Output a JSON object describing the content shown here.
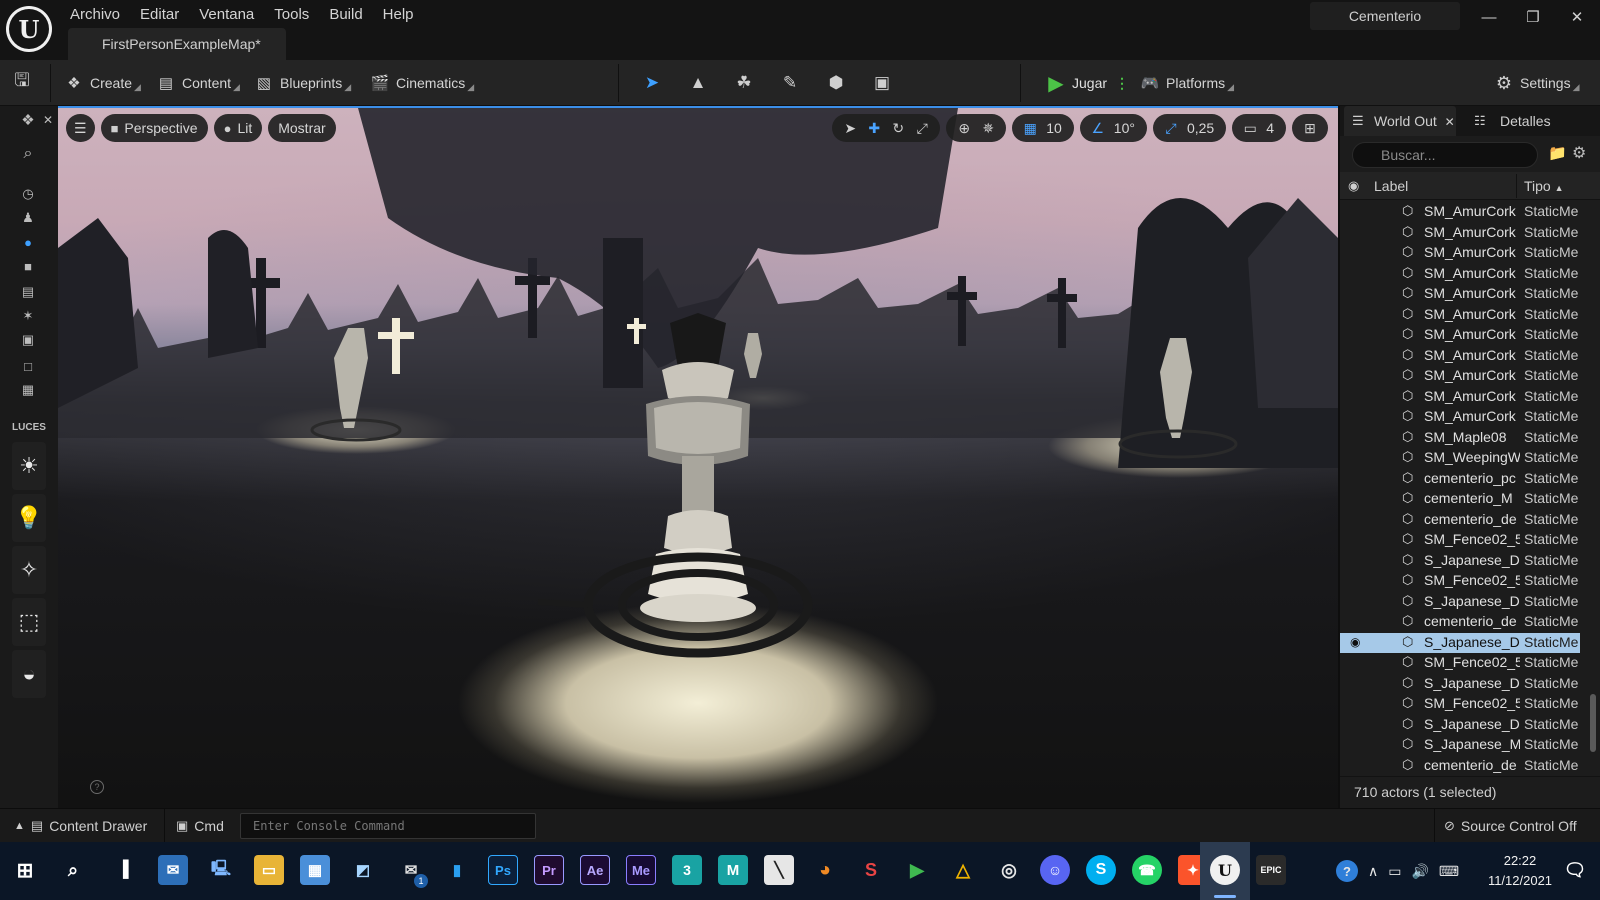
{
  "colors": {
    "accent_blue": "#3b8ee8",
    "selected_row": "#a6c9e8",
    "play_green": "#4cc247",
    "bg_dark": "#151515",
    "taskbar": "#0b1626"
  },
  "titlebar": {
    "menu": [
      "Archivo",
      "Editar",
      "Ventana",
      "Tools",
      "Build",
      "Help"
    ],
    "document_tab": "FirstPersonExampleMap*",
    "project_name": "Cementerio",
    "window_controls": [
      "minimize-icon",
      "restore-icon",
      "close-icon"
    ]
  },
  "toolbar": {
    "create": "Create",
    "content": "Content",
    "blueprints": "Blueprints",
    "cinematics": "Cinematics",
    "modes": [
      "select-mode-icon",
      "landscape-mode-icon",
      "foliage-mode-icon",
      "mesh-paint-mode-icon",
      "fracture-mode-icon",
      "modeling-mode-icon"
    ],
    "play": "Jugar",
    "platforms": "Platforms",
    "settings": "Settings"
  },
  "left_strip": {
    "section_label": "LUCES"
  },
  "viewport": {
    "perspective": "Perspective",
    "lit": "Lit",
    "show": "Mostrar",
    "grid_snap": "10",
    "rotation_snap": "10°",
    "scale_snap": "0,25",
    "camera_speed": "4"
  },
  "outliner": {
    "tab_world": "World Out",
    "tab_details": "Detalles",
    "search_placeholder": "Buscar...",
    "col_label": "Label",
    "col_type": "Tipo",
    "rows": [
      {
        "label": "SM_AmurCork",
        "type": "StaticMe"
      },
      {
        "label": "SM_AmurCork",
        "type": "StaticMe"
      },
      {
        "label": "SM_AmurCork",
        "type": "StaticMe"
      },
      {
        "label": "SM_AmurCork",
        "type": "StaticMe"
      },
      {
        "label": "SM_AmurCork",
        "type": "StaticMe"
      },
      {
        "label": "SM_AmurCork",
        "type": "StaticMe"
      },
      {
        "label": "SM_AmurCork",
        "type": "StaticMe"
      },
      {
        "label": "SM_AmurCork",
        "type": "StaticMe"
      },
      {
        "label": "SM_AmurCork",
        "type": "StaticMe"
      },
      {
        "label": "SM_AmurCork",
        "type": "StaticMe"
      },
      {
        "label": "SM_AmurCork",
        "type": "StaticMe"
      },
      {
        "label": "SM_Maple08",
        "type": "StaticMe"
      },
      {
        "label": "SM_WeepingW",
        "type": "StaticMe"
      },
      {
        "label": "cementerio_pc",
        "type": "StaticMe"
      },
      {
        "label": "cementerio_M",
        "type": "StaticMe"
      },
      {
        "label": "cementerio_de",
        "type": "StaticMe"
      },
      {
        "label": "SM_Fence02_5",
        "type": "StaticMe"
      },
      {
        "label": "S_Japanese_D",
        "type": "StaticMe"
      },
      {
        "label": "SM_Fence02_5",
        "type": "StaticMe"
      },
      {
        "label": "S_Japanese_D",
        "type": "StaticMe"
      },
      {
        "label": "cementerio_de",
        "type": "StaticMe"
      },
      {
        "label": "S_Japanese_D",
        "type": "StaticMe",
        "selected": true
      },
      {
        "label": "SM_Fence02_5",
        "type": "StaticMe"
      },
      {
        "label": "S_Japanese_D",
        "type": "StaticMe"
      },
      {
        "label": "SM_Fence02_5",
        "type": "StaticMe"
      },
      {
        "label": "S_Japanese_D",
        "type": "StaticMe"
      },
      {
        "label": "S_Japanese_M",
        "type": "StaticMe"
      },
      {
        "label": "cementerio_de",
        "type": "StaticMe"
      }
    ],
    "footer": "710 actors (1 selected)"
  },
  "statusbar": {
    "content_drawer": "Content Drawer",
    "cmd": "Cmd",
    "console_placeholder": "Enter Console Command",
    "source_control": "Source Control Off"
  },
  "taskbar": {
    "apps": [
      "Ps",
      "Pr",
      "Ae",
      "Me",
      "3",
      "M",
      "S",
      "EPIC"
    ],
    "time": "22:22",
    "date": "11/12/2021",
    "mail_badge": "1"
  }
}
